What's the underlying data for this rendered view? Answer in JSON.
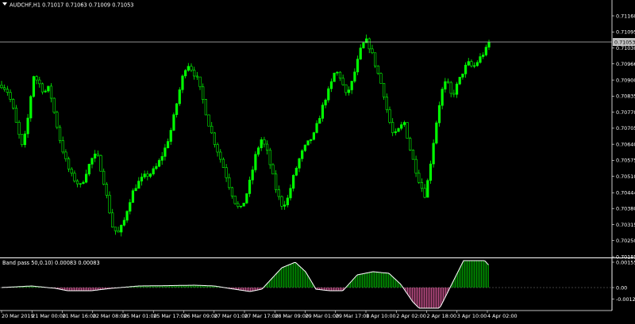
{
  "header": {
    "symbol_line": "AUDCHF,H1  0.71017 0.71063 0.71009 0.71053",
    "menu_arrow": "triangle-down-icon"
  },
  "indicator": {
    "title": "Band pass 50,0.10) 0.00083 0.00083",
    "y_ticks": [
      "0.00155",
      "0.00",
      "-0.00125"
    ],
    "y_values": [
      0.00155,
      0.0,
      -0.00125
    ]
  },
  "colors": {
    "background": "#000000",
    "bull": "#00ff00",
    "bear": "#000000",
    "wick": "#00ff00",
    "price_line": "#c0c0c0",
    "histogram_up": "#00c800",
    "histogram_down": "#ff69b4",
    "oscillator_line": "#ffffff",
    "axis_text": "#ffffff"
  },
  "chart_data": {
    "type": "candlestick",
    "symbol": "AUDCHF",
    "timeframe": "H1",
    "ohlc_shown": {
      "open": 0.71017,
      "high": 0.71063,
      "low": 0.71009,
      "close": 0.71053
    },
    "y_ticks": [
      0.7116,
      0.71095,
      0.7103,
      0.70966,
      0.709,
      0.70835,
      0.7077,
      0.70705,
      0.7064,
      0.70575,
      0.7051,
      0.70444,
      0.7038,
      0.70315,
      0.7025,
      0.70185
    ],
    "y_tick_labels": [
      "0.71160",
      "0.71095",
      "0.71030",
      "0.70966",
      "0.70900",
      "0.70835",
      "0.70770",
      "0.70705",
      "0.70640",
      "0.70575",
      "0.70510",
      "0.70444",
      "0.70380",
      "0.70315",
      "0.70250",
      "0.70185"
    ],
    "current_price_label": "0.71053",
    "current_price": 0.71053,
    "x_tick_labels": [
      "20 Mar 2019",
      "21 Mar 00:00",
      "21 Mar 16:00",
      "22 Mar 08:00",
      "25 Mar 01:00",
      "25 Mar 17:00",
      "26 Mar 09:00",
      "27 Mar 01:00",
      "27 Mar 17:00",
      "28 Mar 09:00",
      "29 Mar 01:00",
      "29 Mar 17:00",
      "1 Apr 10:00",
      "2 Apr 02:00",
      "2 Apr 18:00",
      "3 Apr 10:00",
      "4 Apr 02:00"
    ],
    "price_path": [
      0.7088,
      0.7086,
      0.708,
      0.707,
      0.7062,
      0.7075,
      0.7092,
      0.7089,
      0.7085,
      0.7087,
      0.7076,
      0.7066,
      0.7058,
      0.7052,
      0.7049,
      0.7047,
      0.7053,
      0.7058,
      0.706,
      0.7052,
      0.7041,
      0.703,
      0.7028,
      0.7032,
      0.704,
      0.7046,
      0.7049,
      0.7051,
      0.7052,
      0.7054,
      0.7058,
      0.7063,
      0.707,
      0.708,
      0.709,
      0.7097,
      0.7094,
      0.709,
      0.7082,
      0.7073,
      0.7066,
      0.706,
      0.7054,
      0.7047,
      0.7041,
      0.7037,
      0.7042,
      0.705,
      0.706,
      0.7066,
      0.7062,
      0.7053,
      0.7044,
      0.7039,
      0.7042,
      0.705,
      0.7057,
      0.7062,
      0.7065,
      0.7068,
      0.7075,
      0.7082,
      0.7087,
      0.7094,
      0.7091,
      0.7084,
      0.7088,
      0.7096,
      0.7104,
      0.7106,
      0.71,
      0.7093,
      0.7086,
      0.7075,
      0.7067,
      0.707,
      0.7073,
      0.7063,
      0.7055,
      0.7048,
      0.7043,
      0.7057,
      0.7072,
      0.7085,
      0.709,
      0.7083,
      0.7088,
      0.7093,
      0.7097,
      0.7095,
      0.7098,
      0.7101,
      0.7104
    ]
  }
}
